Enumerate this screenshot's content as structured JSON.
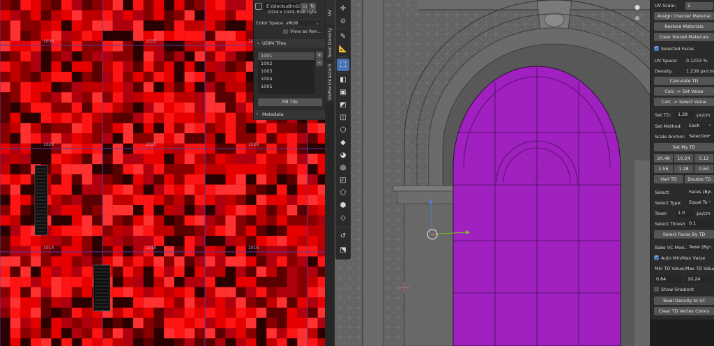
{
  "uv_editor": {
    "tile_labels": [
      "1034",
      "1035",
      "1036",
      "1024",
      "1025",
      "1026",
      "1014",
      "1015",
      "1016"
    ],
    "image": {
      "name": "E:\\blockudim102...",
      "info": "1024 x 1024,  RGB byte",
      "color_space_label": "Color Space",
      "color_space_value": "sRGB",
      "view_as_render": "View as Ren..."
    },
    "udim_tiles": {
      "header": "UDIM Tiles",
      "items": [
        "1001",
        "1002",
        "1003",
        "1004",
        "1005"
      ],
      "selected": "1001",
      "fill_tile": "Fill Tile"
    },
    "metadata_header": "Metadata"
  },
  "side_tabs": [
    "UV Squares",
    "Texel Density",
    "UVPackmaster3"
  ],
  "sidebar": {
    "uv_scale_label": "UV Scale:",
    "uv_scale_value": "1",
    "assign_checker": "Assign Checker Material",
    "restore_materials": "Restore Materials",
    "clear_stored": "Clear Stored Materials",
    "selected_faces": "Selected Faces",
    "uv_space_label": "UV Space:",
    "uv_space_value": "0.1253 %",
    "density_label": "Density:",
    "density_value": "1.238 px/cm",
    "calculate_td": "Calculate TD",
    "calc_set_value": "Calc -> Set Value",
    "calc_select_value": "Calc -> Select Value",
    "set_td_label": "Set TD:",
    "set_td_value": "1.28",
    "set_td_unit": "px/cm",
    "set_method_label": "Set Method:",
    "set_method_value": "Each",
    "scale_anchor_label": "Scale Anchor:",
    "scale_anchor_value": "Selection",
    "set_my_td": "Set My TD",
    "td_presets": [
      "20.48",
      "10.24",
      "5.12",
      "2.56",
      "1.28",
      "0.64"
    ],
    "half_td": "Half TD",
    "double_td": "Double TD",
    "select_label": "Select:",
    "select_value": "Faces (By...",
    "select_type_label": "Select Type:",
    "select_type_value": "Equal To",
    "texel_label": "Texel:",
    "texel_value": "1.0",
    "texel_unit": "px/cm",
    "select_thresh_label": "Select Thresh",
    "select_thresh_value": "0.1",
    "select_faces_by_td": "Select Faces By TD",
    "bake_vc_label": "Bake VC Mod...",
    "bake_vc_value": "Texel (By...",
    "auto_minmax": "Auto Min/Max Value",
    "min_td_label": "Min TD Value:",
    "max_td_label": "Max TD Value:",
    "min_td_value": "0.64",
    "max_td_value": "10.24",
    "show_gradient": "Show Gradient",
    "texel_to_vc": "Texel Density to VC",
    "clear_td_vc": "Clear TD Vertex Colors"
  },
  "colors": {
    "uv_red_bright": "#ff1a1a",
    "uv_red_dark": "#2a0000",
    "face_selected": "#a020c0",
    "accent_blue": "#4772b3"
  }
}
